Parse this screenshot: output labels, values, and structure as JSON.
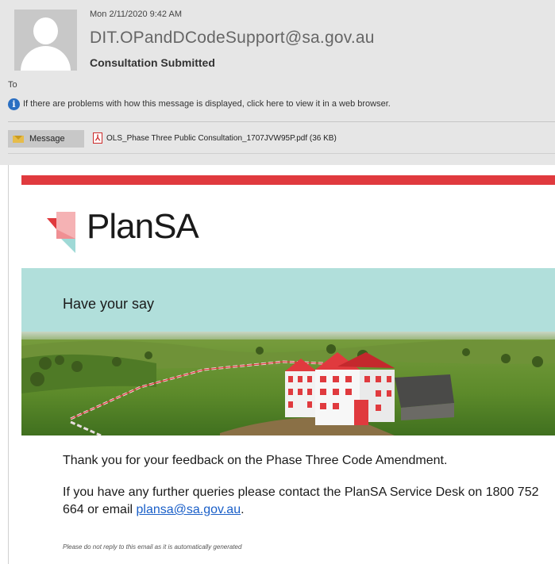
{
  "email": {
    "date": "Mon 2/11/2020 9:42 AM",
    "sender": "DIT.OPandDCodeSupport@sa.gov.au",
    "subject": "Consultation Submitted",
    "to_label": "To",
    "info_message": "If there are problems with how this message is displayed, click here to view it in a web browser."
  },
  "attachments_bar": {
    "message_tab": "Message",
    "attachment": "OLS_Phase Three Public Consultation_1707JVW95P.pdf (36 KB)"
  },
  "body": {
    "brand": "PlanSA",
    "banner_text": "Have your say",
    "thanks": "Thank you for your feedback on the Phase Three Code Amendment.",
    "query_text": "If you have any further queries please contact the PlanSA Service Desk on 1800 752 664 or email ",
    "email_link": "plansa@sa.gov.au",
    "query_end": ".",
    "footer_note": "Please do not reply to this email as it is automatically generated"
  },
  "colors": {
    "accent_red": "#e03a3e",
    "banner_teal": "#b1dfdb",
    "link_blue": "#1a5fc8"
  }
}
